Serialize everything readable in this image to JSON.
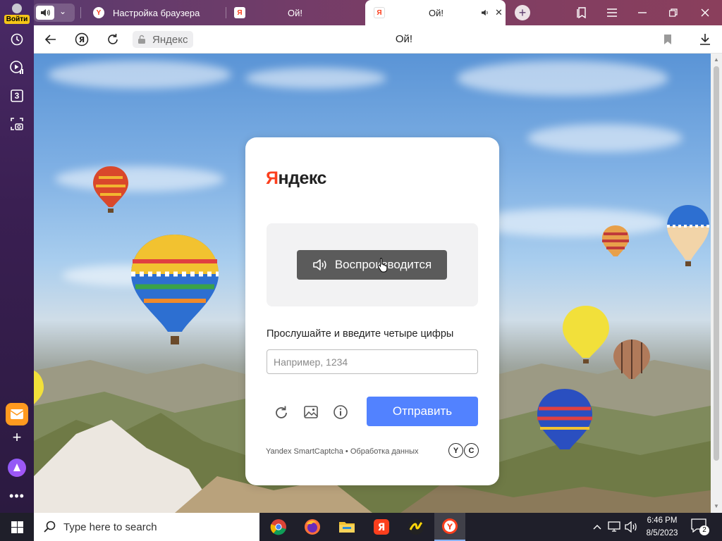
{
  "sidebar": {
    "login_label": "Войти",
    "tab_count": "3",
    "icons": [
      "history-icon",
      "video-icon",
      "tabs-count-icon",
      "screenshot-icon",
      "mail-icon",
      "add-icon",
      "alice-icon",
      "more-icon"
    ]
  },
  "tabs": [
    {
      "title": "Настройка браузера",
      "favicon": "yandex-browser-icon",
      "active": false
    },
    {
      "title": "Ой!",
      "favicon": "yandex-icon",
      "active": false
    },
    {
      "title": "Ой!",
      "favicon": "yandex-icon",
      "active": true,
      "audio_playing": true
    }
  ],
  "addressbar": {
    "domain": "Яндекс",
    "page_title": "Ой!"
  },
  "captcha": {
    "logo_first": "Я",
    "logo_rest": "ндекс",
    "play_button_label": "Воспроизводится",
    "instruction": "Прослушайте и введите четыре цифры",
    "answer_value": "",
    "answer_placeholder": "Например, 1234",
    "submit_label": "Отправить",
    "footer_service": "Yandex SmartCaptcha",
    "footer_separator": "•",
    "footer_link": "Обработка данных",
    "footer_logo_letters": [
      "Y",
      "C"
    ]
  },
  "taskbar": {
    "search_placeholder": "Type here to search",
    "apps": [
      "chrome-icon",
      "firefox-icon",
      "file-explorer-icon",
      "yandex-icon",
      "yandex-music-icon",
      "yandex-browser-icon"
    ],
    "time": "6:46 PM",
    "date": "8/5/2023",
    "notification_count": "2"
  },
  "colors": {
    "yandex_red": "#fc3f1d",
    "submit_blue": "#5282ff",
    "sidebar_purple": "#3a1f52"
  }
}
